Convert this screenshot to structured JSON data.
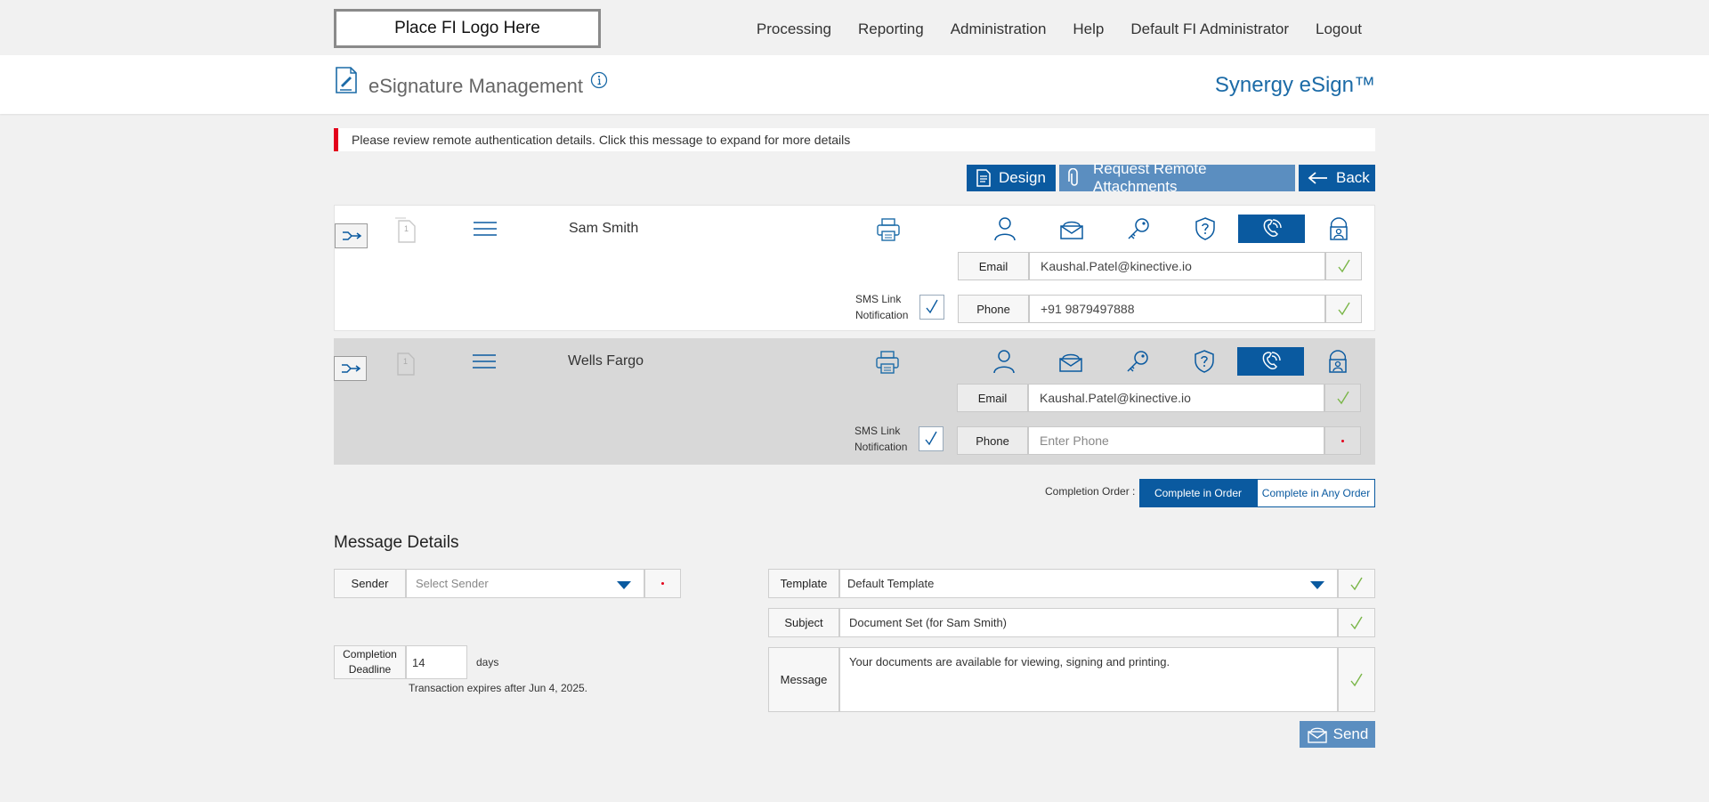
{
  "header": {
    "logo_text": "Place FI Logo Here",
    "nav": [
      "Processing",
      "Reporting",
      "Administration",
      "Help",
      "Default FI Administrator",
      "Logout"
    ]
  },
  "titlebar": {
    "title": "eSignature Management",
    "brand": "Synergy eSign™"
  },
  "alert": {
    "text": "Please review remote authentication details. Click this message to expand for more details"
  },
  "actions": {
    "design": "Design",
    "request_attachments": "Request Remote Attachments",
    "back": "Back"
  },
  "signers": [
    {
      "name": "Sam Smith",
      "doc_number": "1",
      "email_label": "Email",
      "email": "Kaushal.Patel@kinective.io",
      "phone_label": "Phone",
      "phone": "+91 9879497888",
      "phone_placeholder": "Enter Phone",
      "sms_label_1": "SMS Link",
      "sms_label_2": "Notification",
      "active_auth": "phone"
    },
    {
      "name": "Wells Fargo",
      "doc_number": "1",
      "email_label": "Email",
      "email": "Kaushal.Patel@kinective.io",
      "phone_label": "Phone",
      "phone": "",
      "phone_placeholder": "Enter Phone",
      "sms_label_1": "SMS Link",
      "sms_label_2": "Notification",
      "active_auth": "phone"
    }
  ],
  "completion_order": {
    "label": "Completion Order :",
    "options": [
      "Complete in Order",
      "Complete in Any Order"
    ],
    "selected": "Complete in Order"
  },
  "message_details": {
    "title": "Message Details",
    "sender_label": "Sender",
    "sender_placeholder": "Select Sender",
    "deadline_label_1": "Completion",
    "deadline_label_2": "Deadline",
    "deadline_value": "14",
    "days": "days",
    "expires": "Transaction expires after Jun 4, 2025.",
    "template_label": "Template",
    "template_value": "Default Template",
    "subject_label": "Subject",
    "subject_value": "Document Set (for Sam Smith)",
    "message_label": "Message",
    "message_value": "Your documents are available for viewing, signing and printing."
  },
  "send": "Send",
  "colors": {
    "primary": "#0a5aa0",
    "primary_light": "#5b8ec0",
    "alert": "#e3001b",
    "check": "#7ab648",
    "brand": "#1c6ba7"
  }
}
